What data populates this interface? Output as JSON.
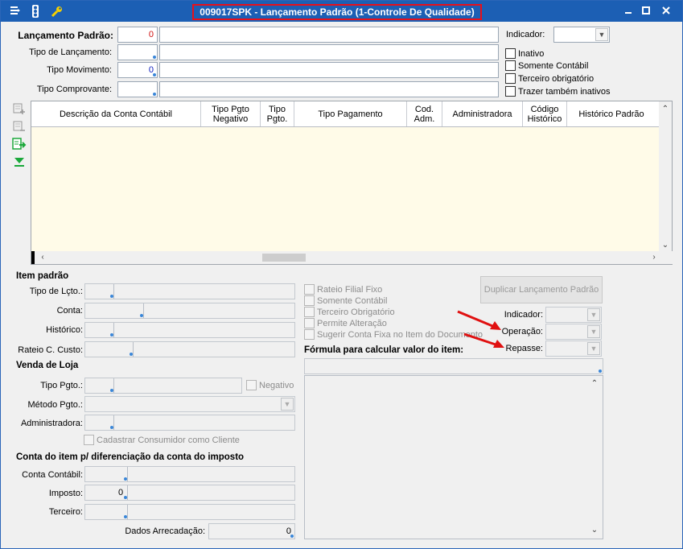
{
  "window": {
    "title": "009017SPK - Lançamento Padrão (1-Controle De Qualidade)"
  },
  "header": {
    "lancamento_padrao_label": "Lançamento Padrão:",
    "lancamento_padrao_value": "0",
    "tipo_lancamento_label": "Tipo de Lançamento:",
    "tipo_movimento_label": "Tipo Movimento:",
    "tipo_movimento_value": "0",
    "tipo_comprovante_label": "Tipo Comprovante:",
    "indicador_label": "Indicador:",
    "checks": [
      "Inativo",
      "Somente Contábil",
      "Terceiro obrigatório",
      "Trazer também inativos"
    ]
  },
  "grid": {
    "columns": [
      "Descrição da Conta Contábil",
      "Tipo Pgto Negativo",
      "Tipo Pgto.",
      "Tipo Pagamento",
      "Cod. Adm.",
      "Administradora",
      "Código Histórico",
      "Histórico Padrão"
    ]
  },
  "item_padrao": {
    "title": "Item padrão",
    "tipo_lcto_label": "Tipo de Lçto.:",
    "conta_label": "Conta:",
    "historico_label": "Histórico:",
    "rateio_label": "Rateio C. Custo:",
    "checks": [
      "Rateio Filial Fixo",
      "Somente Contábil",
      "Terceiro Obrigatório",
      "Permite Alteração",
      "Sugerir Conta Fixa no Item do Documento"
    ],
    "duplicar_button": "Duplicar Lançamento Padrão",
    "indicador_label": "Indicador:",
    "operacao_label": "Operação:",
    "repasse_label": "Repasse:",
    "formula_label": "Fórmula para calcular valor do item:"
  },
  "venda_loja": {
    "title": "Venda de Loja",
    "tipo_pgto_label": "Tipo Pgto.:",
    "negativo_label": "Negativo",
    "metodo_pgto_label": "Método Pgto.:",
    "administradora_label": "Administradora:",
    "cadastrar_label": "Cadastrar Consumidor como Cliente"
  },
  "conta_item": {
    "title": "Conta do item p/ diferenciação da conta do imposto",
    "conta_contabil_label": "Conta Contábil:",
    "imposto_label": "Imposto:",
    "imposto_value": "0",
    "terceiro_label": "Terceiro:",
    "dados_arrecadacao_label": "Dados Arrecadação:",
    "dados_arrecadacao_value": "0"
  },
  "colors": {
    "titlebar": "#1c5fb4",
    "highlight": "#e8101a",
    "grid_background": "#fffbe8",
    "annotation_arrow": "#e01010"
  },
  "icons": [
    "menu-icon",
    "traffic-light-icon",
    "wrench-icon",
    "minimize-icon",
    "maximize-icon",
    "close-icon",
    "add-row-icon",
    "remove-row-icon",
    "export-icon",
    "move-down-icon"
  ]
}
